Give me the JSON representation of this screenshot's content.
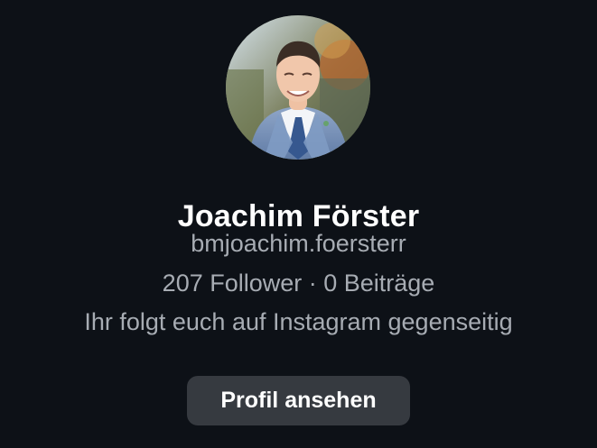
{
  "profile": {
    "name": "Joachim Förster",
    "username": "bmjoachim.foersterr",
    "stats": "207 Follower · 0 Beiträge",
    "mutual_text": "Ihr folgt euch auf Instagram gegenseitig",
    "view_profile_label": "Profil ansehen"
  },
  "colors": {
    "background": "#0d1117",
    "primary_text": "#ffffff",
    "secondary_text": "#a7acb3",
    "button_background": "#363a40"
  }
}
